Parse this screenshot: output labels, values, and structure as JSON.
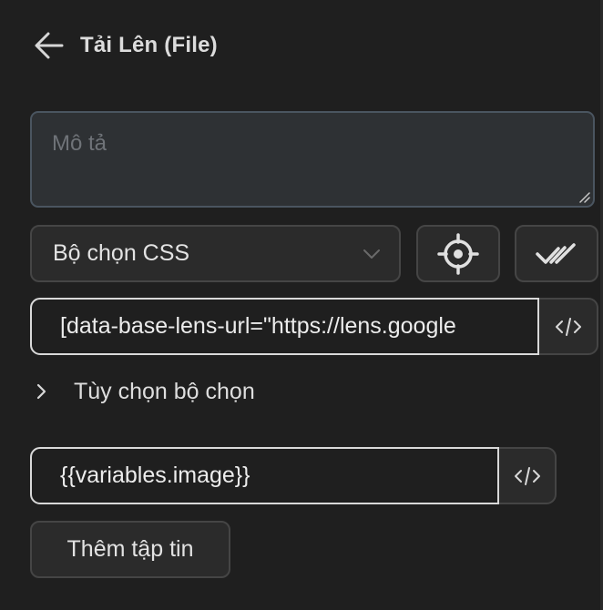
{
  "header": {
    "back_icon": "arrow-left-icon",
    "title": "Tải Lên (File)"
  },
  "description": {
    "placeholder": "Mô tả",
    "value": ""
  },
  "selector": {
    "type_label": "Bộ chọn CSS",
    "dropdown_icon": "chevron-down-icon",
    "target_icon": "crosshair-icon",
    "verify_icon": "double-check-icon",
    "value": "[data-base-lens-url=\"https://lens.google",
    "code_icon": "code-icon"
  },
  "selector_options": {
    "label": "Tùy chọn bộ chọn",
    "icon": "chevron-right-icon"
  },
  "file": {
    "value": "{{variables.image}}",
    "code_icon": "code-icon",
    "add_label": "Thêm tập tin"
  },
  "colors": {
    "background": "#1f1f1f",
    "control": "#2b2b2b",
    "control_border": "#454545",
    "focus_border": "#4a5560",
    "input_border": "#d9d9d9"
  }
}
